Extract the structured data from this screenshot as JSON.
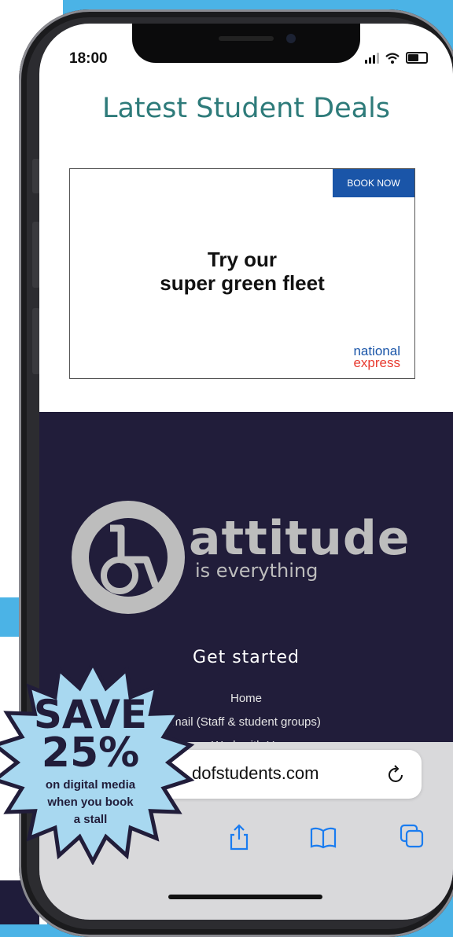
{
  "status_bar": {
    "time": "18:00"
  },
  "page": {
    "title": "Latest Student Deals"
  },
  "ad": {
    "cta": "BOOK NOW",
    "headline_line1": "Try our",
    "headline_line2": "super green fleet",
    "brand_line1": "national",
    "brand_line2": "express"
  },
  "footer": {
    "logo_word": "attitude",
    "logo_tagline": "is everything",
    "heading": "Get started",
    "links": [
      "Home",
      "mail (Staff & student groups)",
      "Work with Us"
    ]
  },
  "browser": {
    "url": "dofstudents.com"
  },
  "promo_badge": {
    "line1": "SAVE",
    "line2": "25%",
    "line3": "on digital media",
    "line4": "when you book",
    "line5": "a stall"
  },
  "colors": {
    "background": "#4bb3e6",
    "title": "#2e7b7a",
    "footer_bg": "#211d3a",
    "cta_blue": "#1a55a8",
    "brand_red": "#e83a2f",
    "badge_fill": "#a8d8f0"
  }
}
